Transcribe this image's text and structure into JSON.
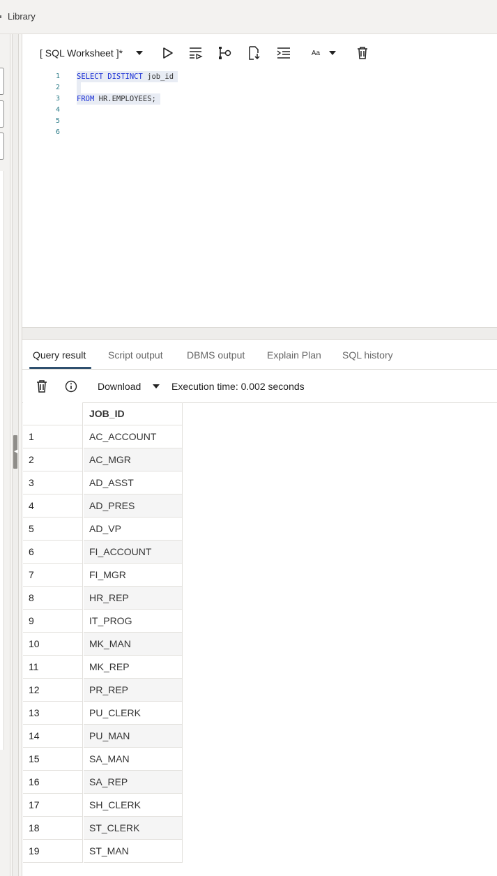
{
  "topbar": {
    "library_label": "Library"
  },
  "worksheet": {
    "title": "[ SQL Worksheet ]*",
    "font_size_label": "Aa"
  },
  "toolbar_icons": [
    "dropdown-caret-icon",
    "run-statement-icon",
    "run-script-icon",
    "explain-plan-icon",
    "export-icon",
    "format-icon",
    "font-size-icon",
    "clear-icon"
  ],
  "editor": {
    "line_numbers": [
      "1",
      "2",
      "3",
      "4",
      "5",
      "6"
    ],
    "lines": [
      {
        "kw": "SELECT DISTINCT",
        "rest": " job_id"
      },
      {
        "kw": "",
        "rest": ""
      },
      {
        "kw": "FROM",
        "rest": " HR.EMPLOYEES;"
      }
    ],
    "colors": {
      "keyword": "#1a2fd6",
      "line_number": "#2a7a87",
      "highlight": "#e8ecf4"
    }
  },
  "tabs": [
    {
      "label": "Query result",
      "active": true
    },
    {
      "label": "Script output"
    },
    {
      "label": "DBMS output"
    },
    {
      "label": "Explain Plan"
    },
    {
      "label": "SQL history"
    }
  ],
  "result_bar": {
    "download_label": "Download",
    "execution_time": "Execution time: 0.002 seconds"
  },
  "grid": {
    "column": "JOB_ID",
    "rows": [
      {
        "n": "1",
        "v": "AC_ACCOUNT"
      },
      {
        "n": "2",
        "v": "AC_MGR"
      },
      {
        "n": "3",
        "v": "AD_ASST"
      },
      {
        "n": "4",
        "v": "AD_PRES"
      },
      {
        "n": "5",
        "v": "AD_VP"
      },
      {
        "n": "6",
        "v": "FI_ACCOUNT"
      },
      {
        "n": "7",
        "v": "FI_MGR"
      },
      {
        "n": "8",
        "v": "HR_REP"
      },
      {
        "n": "9",
        "v": "IT_PROG"
      },
      {
        "n": "10",
        "v": "MK_MAN"
      },
      {
        "n": "11",
        "v": "MK_REP"
      },
      {
        "n": "12",
        "v": "PR_REP"
      },
      {
        "n": "13",
        "v": "PU_CLERK"
      },
      {
        "n": "14",
        "v": "PU_MAN"
      },
      {
        "n": "15",
        "v": "SA_MAN"
      },
      {
        "n": "16",
        "v": "SA_REP"
      },
      {
        "n": "17",
        "v": "SH_CLERK"
      },
      {
        "n": "18",
        "v": "ST_CLERK"
      },
      {
        "n": "19",
        "v": "ST_MAN"
      }
    ]
  }
}
